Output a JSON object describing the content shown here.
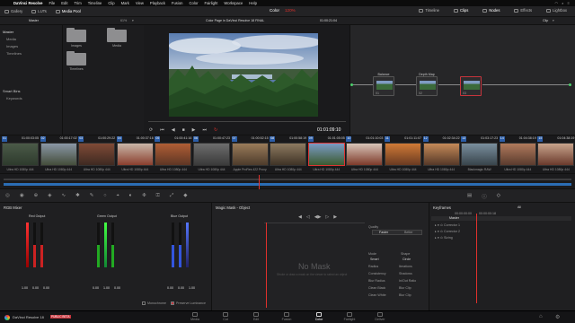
{
  "menubar": {
    "app": "DaVinci Resolve",
    "items": [
      "File",
      "Edit",
      "Trim",
      "Timeline",
      "Clip",
      "Mark",
      "View",
      "Playback",
      "Fusion",
      "Color",
      "Fairlight",
      "Workspace",
      "Help"
    ]
  },
  "toolbar": {
    "gallery": "Gallery",
    "luts": "LUTs",
    "media_pool": "Media Pool",
    "center_color": "Color",
    "center_rec": "120%",
    "timeline": "Timeline",
    "clips": "Clips",
    "nodes": "Nodes",
    "effects": "Effects",
    "lightbox": "Lightbox"
  },
  "pool": {
    "bin_header": "Master",
    "master": "Master",
    "bins": [
      "Media",
      "Images",
      "Timelines"
    ],
    "smart_bins": "Smart Bins",
    "keywords": "Keywords",
    "folders": [
      "Images",
      "Media",
      "Timelines"
    ],
    "zoom": "61%"
  },
  "viewer": {
    "title": "Color Page in DaVinci Resolve 18 FINAL",
    "tc_top": "01:00:21:04",
    "tc": "01:01:09:10"
  },
  "nodes": {
    "label": "Clip",
    "items": [
      {
        "name": "Balance",
        "num": "01"
      },
      {
        "name": "Depth Map",
        "num": "02"
      },
      {
        "name": "",
        "num": "03"
      }
    ]
  },
  "clips": [
    {
      "n": "01",
      "tc": "01:00:03:05",
      "name": "Ultra HD 1080p 444",
      "c1": "#4b5a48",
      "c2": "#2e3b2d"
    },
    {
      "n": "02",
      "tc": "01:00:17:02",
      "name": "Ultra HD 1080p 444",
      "c1": "#8a97a6",
      "c2": "#444d3b"
    },
    {
      "n": "03",
      "tc": "01:00:29:22",
      "name": "Ultra HD 1080p 444",
      "c1": "#7f4a36",
      "c2": "#3e2a22"
    },
    {
      "n": "04",
      "tc": "01:00:37:16",
      "name": "Ultra HD 1080p 444",
      "c1": "#c9b6a8",
      "c2": "#8a3f2e"
    },
    {
      "n": "05",
      "tc": "01:00:41:16",
      "name": "Ultra HD 1080p 444",
      "c1": "#b05e35",
      "c2": "#5e3625"
    },
    {
      "n": "06",
      "tc": "01:00:47:23",
      "name": "Ultra HD 1080p 444",
      "c1": "#6d6d6d",
      "c2": "#3a3a3a"
    },
    {
      "n": "07",
      "tc": "01:00:52:15",
      "name": "Apple ProRes 422 Proxy",
      "c1": "#9a7c5a",
      "c2": "#4d3b2b"
    },
    {
      "n": "08",
      "tc": "01:00:58:19",
      "name": "Ultra HD 1080p 444",
      "c1": "#8d7a60",
      "c2": "#3f3326"
    },
    {
      "n": "09",
      "tc": "01:01:05:05",
      "name": "Ultra HD 1080p 444",
      "c1": "#7b9bc4",
      "c2": "#3b5a30"
    },
    {
      "n": "10",
      "tc": "01:01:10:03",
      "name": "Ultra HD 1080p 444",
      "c1": "#d8c4b8",
      "c2": "#7d3a2a"
    },
    {
      "n": "11",
      "tc": "01:01:11:07",
      "name": "Ultra HD 1080p 444",
      "c1": "#d07a36",
      "c2": "#6a3a22"
    },
    {
      "n": "12",
      "tc": "01:02:34:22",
      "name": "Ultra HD 1080p 444",
      "c1": "#c58a58",
      "c2": "#553828"
    },
    {
      "n": "13",
      "tc": "01:03:17:23",
      "name": "Blackmagic RAW",
      "c1": "#7a8f9e",
      "c2": "#38444b"
    },
    {
      "n": "14",
      "tc": "01:04:38:19",
      "name": "Ultra HD 1080p 444",
      "c1": "#b07a5c",
      "c2": "#5a3b2e"
    },
    {
      "n": "15",
      "tc": "01:04:38:19",
      "name": "Ultra HD 1080p 444",
      "c1": "#c8a48c",
      "c2": "#6a3a2c"
    }
  ],
  "mixer": {
    "title": "RGB Mixer",
    "red": "Red Output",
    "green": "Green Output",
    "blue": "Blue Output",
    "v1": "1.00",
    "v0": "0.00",
    "mono": "Monochrome",
    "preserve": "Preserve Luminance"
  },
  "mask": {
    "title": "Magic Mask - Object",
    "nomask": "No Mask",
    "hint": "Stroke or draw a mask on the viewer to select an object",
    "quality": "Quality",
    "faster": "Faster",
    "better": "Better",
    "mode": "Mode",
    "shape": "Shape",
    "smart": "Smart",
    "circle": "Circle",
    "params": [
      "Radius",
      "Consistency",
      "Blur Radius",
      "Clean Black",
      "Clean White"
    ],
    "params2": [
      "Iterations",
      "Shadows",
      "In/Out Ratio",
      "Blur Clip",
      "Blur Clip"
    ]
  },
  "keyframes": {
    "title": "Keyframes",
    "all": "All",
    "tc_left": "00:00:00:00",
    "tc_right": "00:00:00:18",
    "rows": [
      "Master",
      "Corrector 1",
      "Corrector 2",
      "Sizing"
    ]
  },
  "pages": {
    "app_label": "DaVinci Resolve 18",
    "public_beta": "PUBLIC BETA",
    "items": [
      "Media",
      "Cut",
      "Edit",
      "Fusion",
      "Color",
      "Fairlight",
      "Deliver"
    ],
    "active": "Color"
  }
}
